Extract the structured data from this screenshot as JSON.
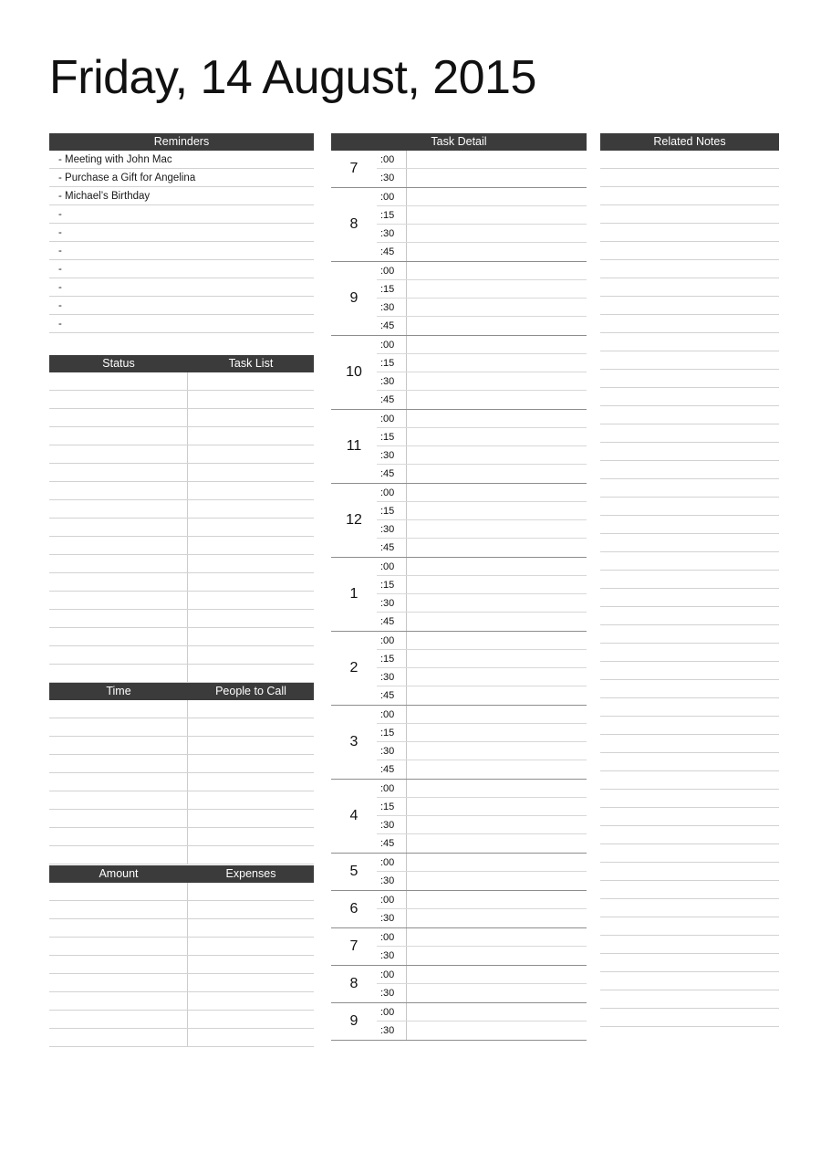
{
  "title": "Friday, 14 August, 2015",
  "reminders": {
    "header": "Reminders",
    "items": [
      "- Meeting with John Mac",
      "- Purchase a Gift for Angelina",
      "- Michael’s Birthday",
      "-",
      "-",
      "-",
      "-",
      "-",
      "-",
      "-"
    ]
  },
  "status_table": {
    "header_left": "Status",
    "header_right": "Task List",
    "rows": [
      {
        "left": "",
        "right": ""
      },
      {
        "left": "",
        "right": ""
      },
      {
        "left": "",
        "right": ""
      },
      {
        "left": "",
        "right": ""
      },
      {
        "left": "",
        "right": ""
      },
      {
        "left": "",
        "right": ""
      },
      {
        "left": "",
        "right": ""
      },
      {
        "left": "",
        "right": ""
      },
      {
        "left": "",
        "right": ""
      },
      {
        "left": "",
        "right": ""
      },
      {
        "left": "",
        "right": ""
      },
      {
        "left": "",
        "right": ""
      },
      {
        "left": "",
        "right": ""
      },
      {
        "left": "",
        "right": ""
      },
      {
        "left": "",
        "right": ""
      },
      {
        "left": "",
        "right": ""
      },
      {
        "left": "",
        "right": ""
      }
    ]
  },
  "time_table": {
    "header_left": "Time",
    "header_right": "People to Call",
    "rows": [
      {
        "left": "",
        "right": ""
      },
      {
        "left": "",
        "right": ""
      },
      {
        "left": "",
        "right": ""
      },
      {
        "left": "",
        "right": ""
      },
      {
        "left": "",
        "right": ""
      },
      {
        "left": "",
        "right": ""
      },
      {
        "left": "",
        "right": ""
      },
      {
        "left": "",
        "right": ""
      },
      {
        "left": "",
        "right": ""
      }
    ]
  },
  "amount_table": {
    "header_left": "Amount",
    "header_right": "Expenses",
    "rows": [
      {
        "left": "",
        "right": ""
      },
      {
        "left": "",
        "right": ""
      },
      {
        "left": "",
        "right": ""
      },
      {
        "left": "",
        "right": ""
      },
      {
        "left": "",
        "right": ""
      },
      {
        "left": "",
        "right": ""
      },
      {
        "left": "",
        "right": ""
      },
      {
        "left": "",
        "right": ""
      },
      {
        "left": "",
        "right": ""
      }
    ]
  },
  "task_detail": {
    "header": "Task Detail",
    "hours": [
      {
        "hour": "7",
        "slots": [
          ":00",
          ":30"
        ],
        "entries": [
          "",
          ""
        ]
      },
      {
        "hour": "8",
        "slots": [
          ":00",
          ":15",
          ":30",
          ":45"
        ],
        "entries": [
          "",
          "",
          "",
          ""
        ]
      },
      {
        "hour": "9",
        "slots": [
          ":00",
          ":15",
          ":30",
          ":45"
        ],
        "entries": [
          "",
          "",
          "",
          ""
        ]
      },
      {
        "hour": "10",
        "slots": [
          ":00",
          ":15",
          ":30",
          ":45"
        ],
        "entries": [
          "",
          "",
          "",
          ""
        ]
      },
      {
        "hour": "11",
        "slots": [
          ":00",
          ":15",
          ":30",
          ":45"
        ],
        "entries": [
          "",
          "",
          "",
          ""
        ]
      },
      {
        "hour": "12",
        "slots": [
          ":00",
          ":15",
          ":30",
          ":45"
        ],
        "entries": [
          "",
          "",
          "",
          ""
        ]
      },
      {
        "hour": "1",
        "slots": [
          ":00",
          ":15",
          ":30",
          ":45"
        ],
        "entries": [
          "",
          "",
          "",
          ""
        ]
      },
      {
        "hour": "2",
        "slots": [
          ":00",
          ":15",
          ":30",
          ":45"
        ],
        "entries": [
          "",
          "",
          "",
          ""
        ]
      },
      {
        "hour": "3",
        "slots": [
          ":00",
          ":15",
          ":30",
          ":45"
        ],
        "entries": [
          "",
          "",
          "",
          ""
        ]
      },
      {
        "hour": "4",
        "slots": [
          ":00",
          ":15",
          ":30",
          ":45"
        ],
        "entries": [
          "",
          "",
          "",
          ""
        ]
      },
      {
        "hour": "5",
        "slots": [
          ":00",
          ":30"
        ],
        "entries": [
          "",
          ""
        ]
      },
      {
        "hour": "6",
        "slots": [
          ":00",
          ":30"
        ],
        "entries": [
          "",
          ""
        ]
      },
      {
        "hour": "7",
        "slots": [
          ":00",
          ":30"
        ],
        "entries": [
          "",
          ""
        ]
      },
      {
        "hour": "8",
        "slots": [
          ":00",
          ":30"
        ],
        "entries": [
          "",
          ""
        ]
      },
      {
        "hour": "9",
        "slots": [
          ":00",
          ":30"
        ],
        "entries": [
          "",
          ""
        ]
      }
    ]
  },
  "related_notes": {
    "header": "Related Notes",
    "lines": [
      "",
      "",
      "",
      "",
      "",
      "",
      "",
      "",
      "",
      "",
      "",
      "",
      "",
      "",
      "",
      "",
      "",
      "",
      "",
      "",
      "",
      "",
      "",
      "",
      "",
      "",
      "",
      "",
      "",
      "",
      "",
      "",
      "",
      "",
      "",
      "",
      "",
      "",
      "",
      "",
      "",
      "",
      "",
      "",
      "",
      "",
      "",
      ""
    ]
  },
  "colors": {
    "header_bar": "#3b3b3b",
    "header_text": "#ffffff",
    "rule_line": "#d2d2d2",
    "hour_rule": "#8d8d8d",
    "page_background": "#ffffff",
    "text": "#111111"
  }
}
